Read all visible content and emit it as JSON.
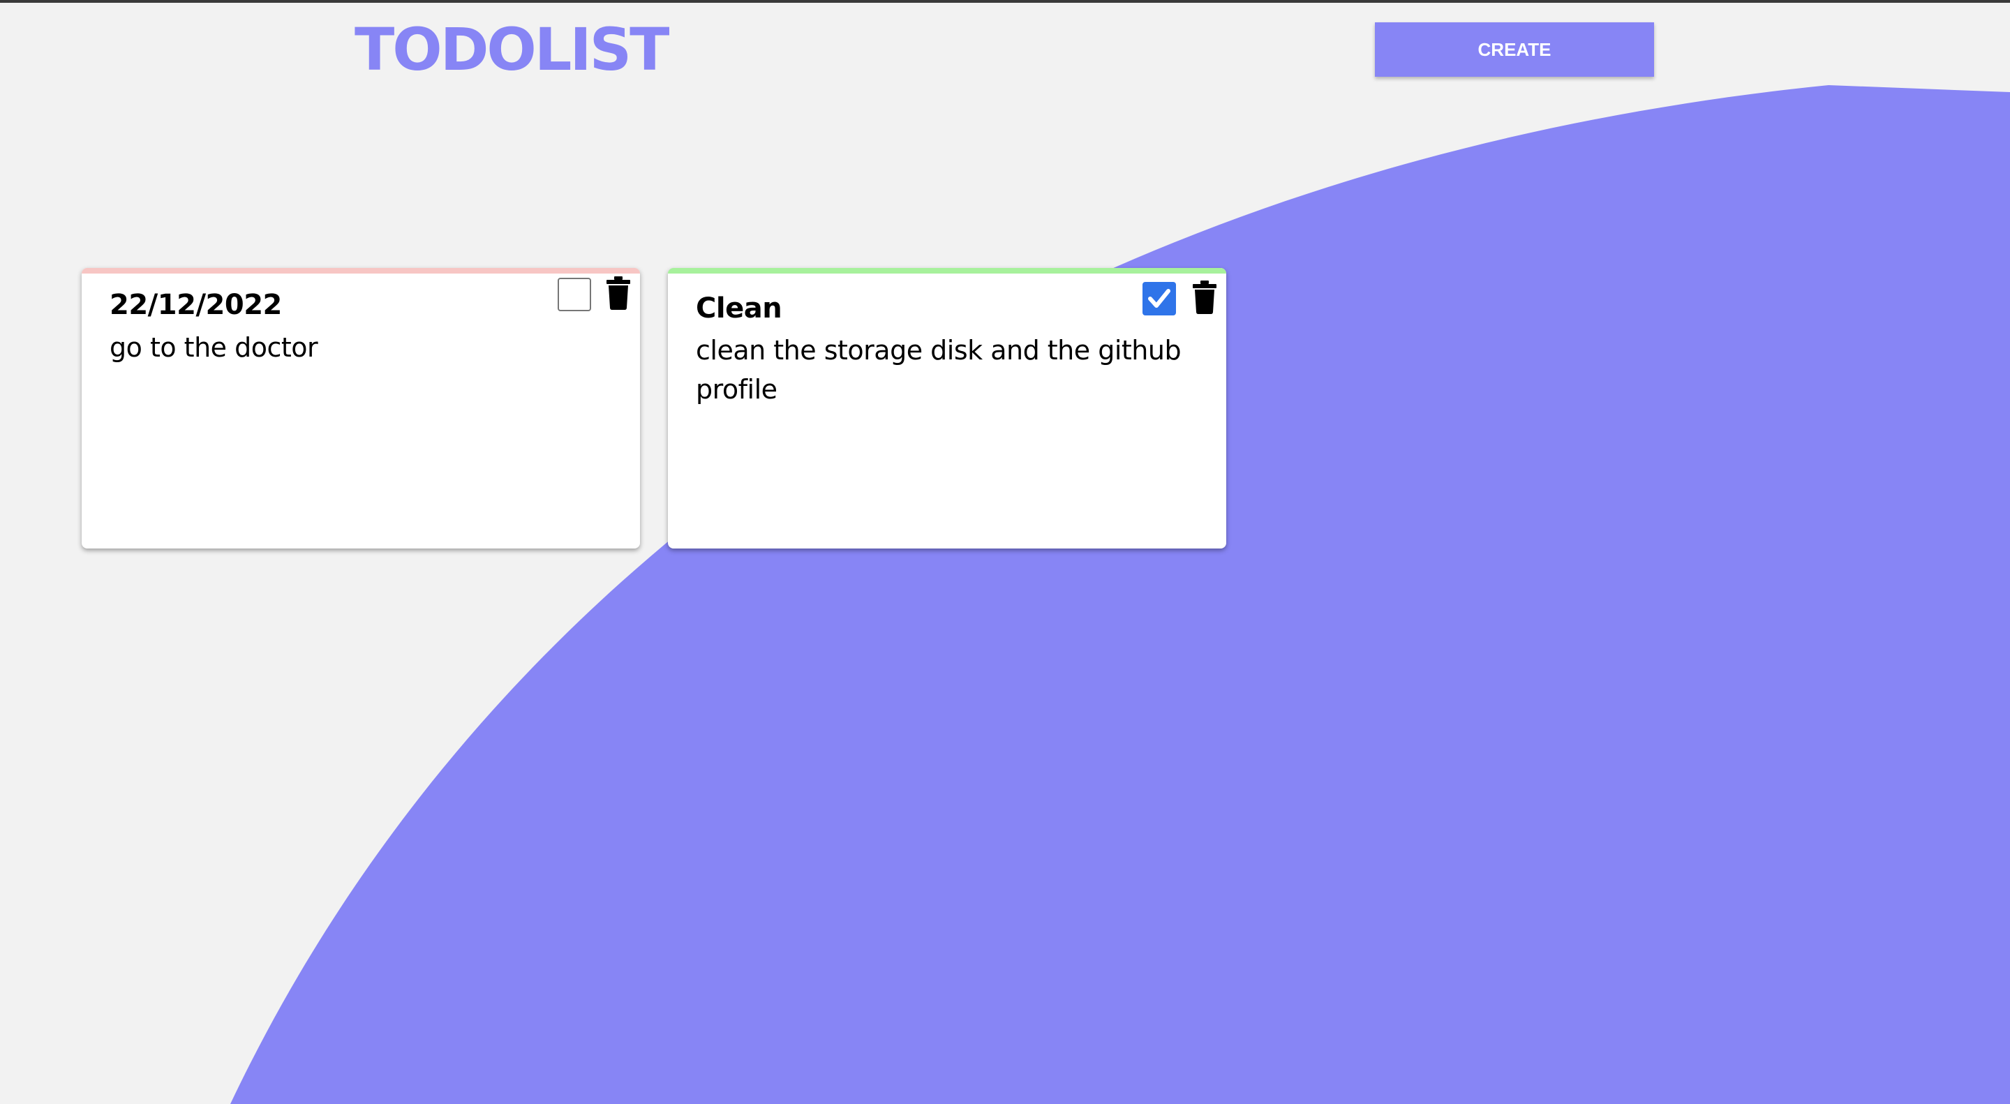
{
  "app": {
    "title": "TODOLIST",
    "create_label": "CREATE"
  },
  "colors": {
    "accent": "#8785f5",
    "page_background": "#f2f2f2",
    "card_background": "#ffffff",
    "pending_stripe": "#f7c6c4",
    "done_stripe": "#a7f19c",
    "checkbox_checked": "#2f74e9"
  },
  "todos": [
    {
      "title": "22/12/2022",
      "description": "go to the doctor",
      "completed": false,
      "checkbox_icon": "checkbox-unchecked-icon",
      "delete_icon": "trash-icon"
    },
    {
      "title": "Clean",
      "description": "clean the storage disk and the github profile",
      "completed": true,
      "checkbox_icon": "checkbox-checked-icon",
      "delete_icon": "trash-icon"
    }
  ]
}
